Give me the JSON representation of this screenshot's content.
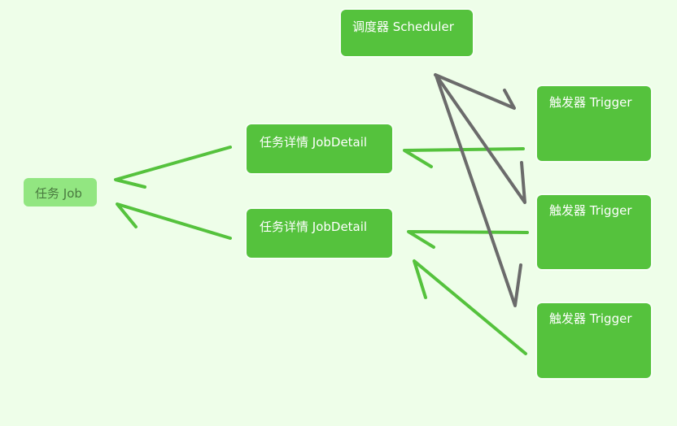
{
  "nodes": {
    "scheduler": "调度器  Scheduler",
    "job": "任务 Job",
    "jobdetail_1": "任务详情   JobDetail",
    "jobdetail_2": "任务详情   JobDetail",
    "trigger_1": "触发器   Trigger",
    "trigger_2": "触发器   Trigger",
    "trigger_3": "触发器   Trigger"
  },
  "colors": {
    "background": "#eefee9",
    "node_fill": "#55c23d",
    "job_fill": "#92e681",
    "green_arrow": "#55c23d",
    "gray_arrow": "#6b6b6b"
  }
}
